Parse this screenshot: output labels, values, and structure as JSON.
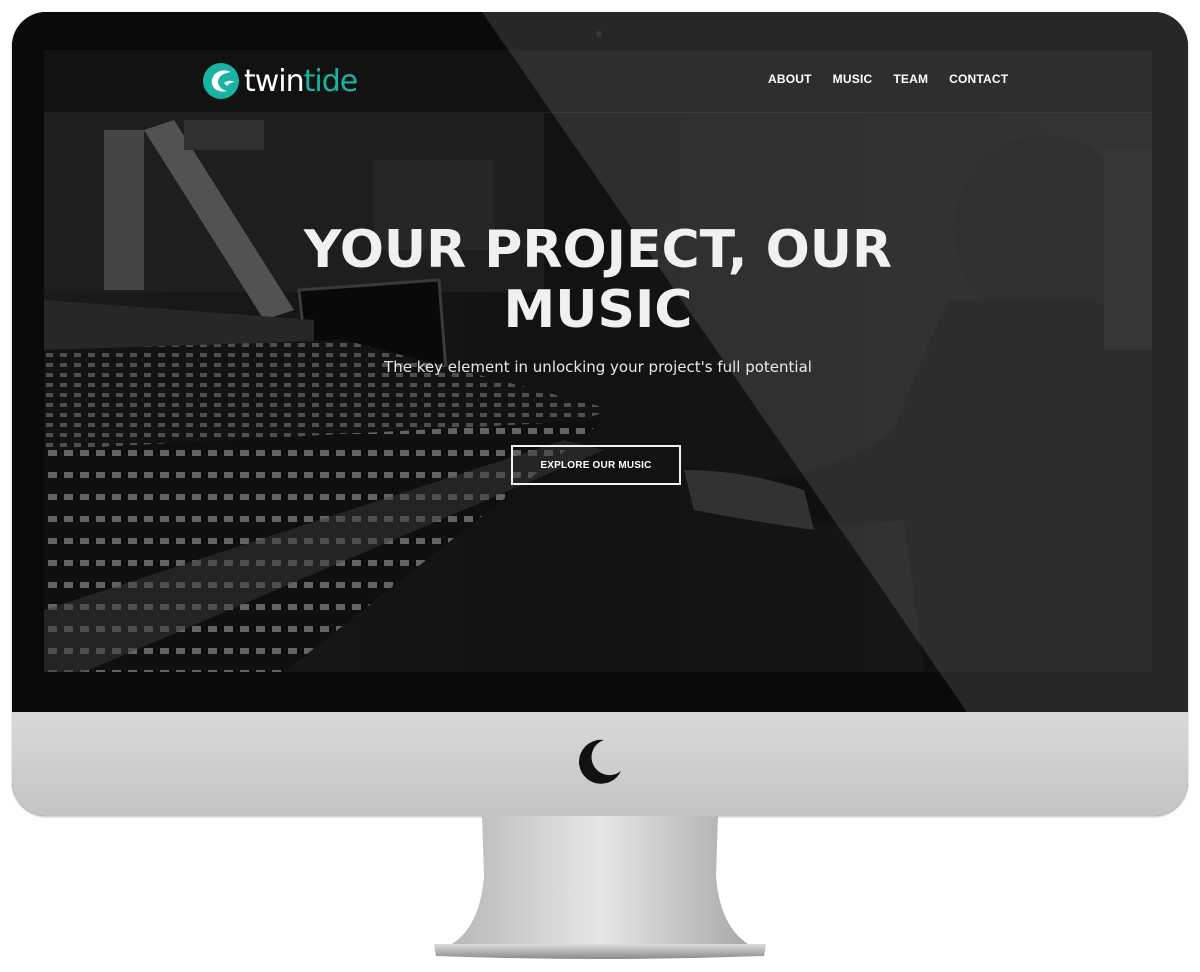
{
  "site": {
    "brand": {
      "prefix": "twin",
      "suffix": "tide",
      "accent_color": "#19b3a3",
      "icon": "wave-logo-icon"
    },
    "nav": {
      "items": [
        "ABOUT",
        "MUSIC",
        "TEAM",
        "CONTACT"
      ]
    },
    "hero": {
      "title": "YOUR PROJECT, OUR MUSIC",
      "subtitle": "The key element in unlocking your project's full potential",
      "cta_label": "EXPLORE OUR MUSIC",
      "background": "studio-mixing-console-photo"
    }
  },
  "device": {
    "type": "desktop monitor",
    "logo_icon": "moon-logo-icon"
  }
}
